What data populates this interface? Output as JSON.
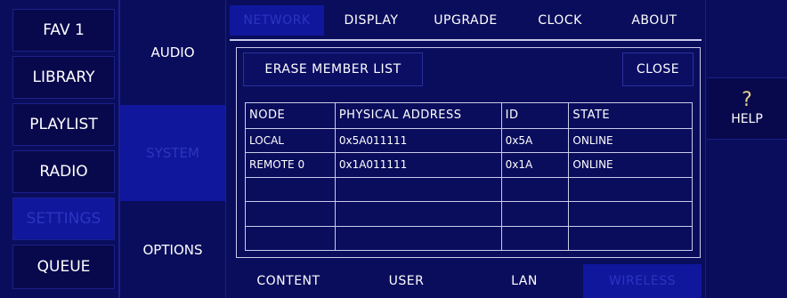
{
  "left_nav": {
    "items": [
      {
        "key": "fav1",
        "label": "FAV 1"
      },
      {
        "key": "library",
        "label": "LIBRARY"
      },
      {
        "key": "playlist",
        "label": "PLAYLIST"
      },
      {
        "key": "radio",
        "label": "RADIO"
      },
      {
        "key": "settings",
        "label": "SETTINGS",
        "active": true
      },
      {
        "key": "queue",
        "label": "QUEUE"
      }
    ]
  },
  "settings_nav": {
    "items": [
      {
        "key": "audio",
        "label": "AUDIO"
      },
      {
        "key": "system",
        "label": "SYSTEM",
        "active": true
      },
      {
        "key": "options",
        "label": "OPTIONS"
      }
    ]
  },
  "top_tabs": {
    "items": [
      {
        "key": "network",
        "label": "NETWORK",
        "active": true
      },
      {
        "key": "display",
        "label": "DISPLAY"
      },
      {
        "key": "upgrade",
        "label": "UPGRADE"
      },
      {
        "key": "clock",
        "label": "CLOCK"
      },
      {
        "key": "about",
        "label": "ABOUT"
      }
    ]
  },
  "panel": {
    "erase_label": "ERASE MEMBER LIST",
    "close_label": "CLOSE"
  },
  "member_table": {
    "headers": [
      "NODE",
      "PHYSICAL ADDRESS",
      "ID",
      "STATE"
    ],
    "rows": [
      [
        "LOCAL",
        "0x5A011111",
        "0x5A",
        "ONLINE"
      ],
      [
        "REMOTE 0",
        "0x1A011111",
        "0x1A",
        "ONLINE"
      ],
      [
        "",
        "",
        "",
        ""
      ],
      [
        "",
        "",
        "",
        ""
      ],
      [
        "",
        "",
        "",
        ""
      ]
    ]
  },
  "bottom_tabs": {
    "items": [
      {
        "key": "content",
        "label": "CONTENT"
      },
      {
        "key": "user",
        "label": "USER"
      },
      {
        "key": "lan",
        "label": "LAN"
      },
      {
        "key": "wireless",
        "label": "WIRELESS",
        "active": true
      }
    ]
  },
  "help": {
    "icon": "?",
    "label": "HELP"
  },
  "colors": {
    "background": "#0a0d5c",
    "active_fill": "#10179d",
    "active_text": "#2c34c0",
    "border": "#c8cbe8"
  }
}
